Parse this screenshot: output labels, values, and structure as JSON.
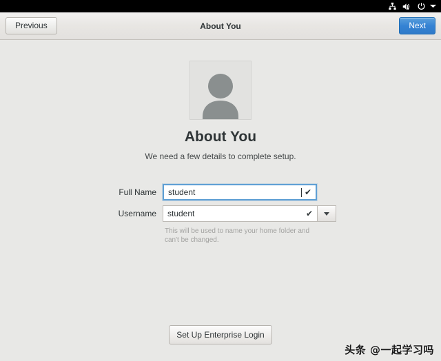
{
  "system_tray": {
    "icons": [
      {
        "name": "network-wired-icon",
        "label": "Network"
      },
      {
        "name": "volume-muted-icon",
        "label": "Volume muted"
      },
      {
        "name": "power-icon",
        "label": "Power"
      },
      {
        "name": "chevron-down-icon",
        "label": "System menu"
      }
    ]
  },
  "header": {
    "previous_label": "Previous",
    "title": "About You",
    "next_label": "Next",
    "next_color": "#3583d4"
  },
  "main": {
    "avatar": {
      "icon": "user-avatar-icon"
    },
    "title": "About You",
    "subtitle": "We need a few details to complete setup.",
    "form": {
      "full_name": {
        "label": "Full Name",
        "value": "student",
        "valid_icon": "checkmark-icon",
        "focused": true
      },
      "username": {
        "label": "Username",
        "value": "student",
        "valid_icon": "checkmark-icon",
        "dropdown_icon": "triangle-down-icon",
        "hint": "This will be used to name your home folder and can't be changed."
      }
    },
    "enterprise_button_label": "Set Up Enterprise Login"
  },
  "watermark": {
    "text": "头条 @一起学习吗"
  }
}
